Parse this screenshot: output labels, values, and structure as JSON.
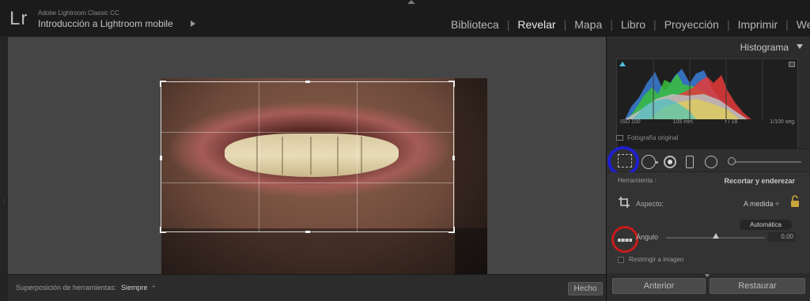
{
  "header": {
    "logo": "Lr",
    "app_name": "Adobe Lightroom Classic CC",
    "catalog": "Introducción a Lightroom mobile"
  },
  "modules": [
    {
      "label": "Biblioteca",
      "active": false
    },
    {
      "label": "Revelar",
      "active": true
    },
    {
      "label": "Mapa",
      "active": false
    },
    {
      "label": "Libro",
      "active": false
    },
    {
      "label": "Proyección",
      "active": false
    },
    {
      "label": "Imprimir",
      "active": false
    },
    {
      "label": "Web",
      "active": false
    }
  ],
  "toolbar": {
    "overlay_label": "Superposición de herramientas:",
    "overlay_value": "Siempre",
    "done_label": "Hecho"
  },
  "histogram": {
    "title": "Histograma",
    "iso": "ISO 100",
    "focal": "105 mm",
    "aperture": "f / 18",
    "shutter": "1/100 seg.",
    "original_label": "Fotografía original"
  },
  "crop_panel": {
    "tool_label": "Herramienta :",
    "tool_name": "Recortar y enderezar",
    "aspect_label": "Aspecto:",
    "aspect_value": "A medida ÷",
    "auto_label": "Automática",
    "angle_label": "Ángulo",
    "angle_value": "0,00",
    "angle_level": 0.5,
    "constrain_label": "Restringir a imagen"
  },
  "buttons": {
    "previous": "Anterior",
    "reset": "Restaurar"
  },
  "colors": {
    "highlight_blue": "#1f1fd0",
    "highlight_red": "#c91a1a"
  }
}
